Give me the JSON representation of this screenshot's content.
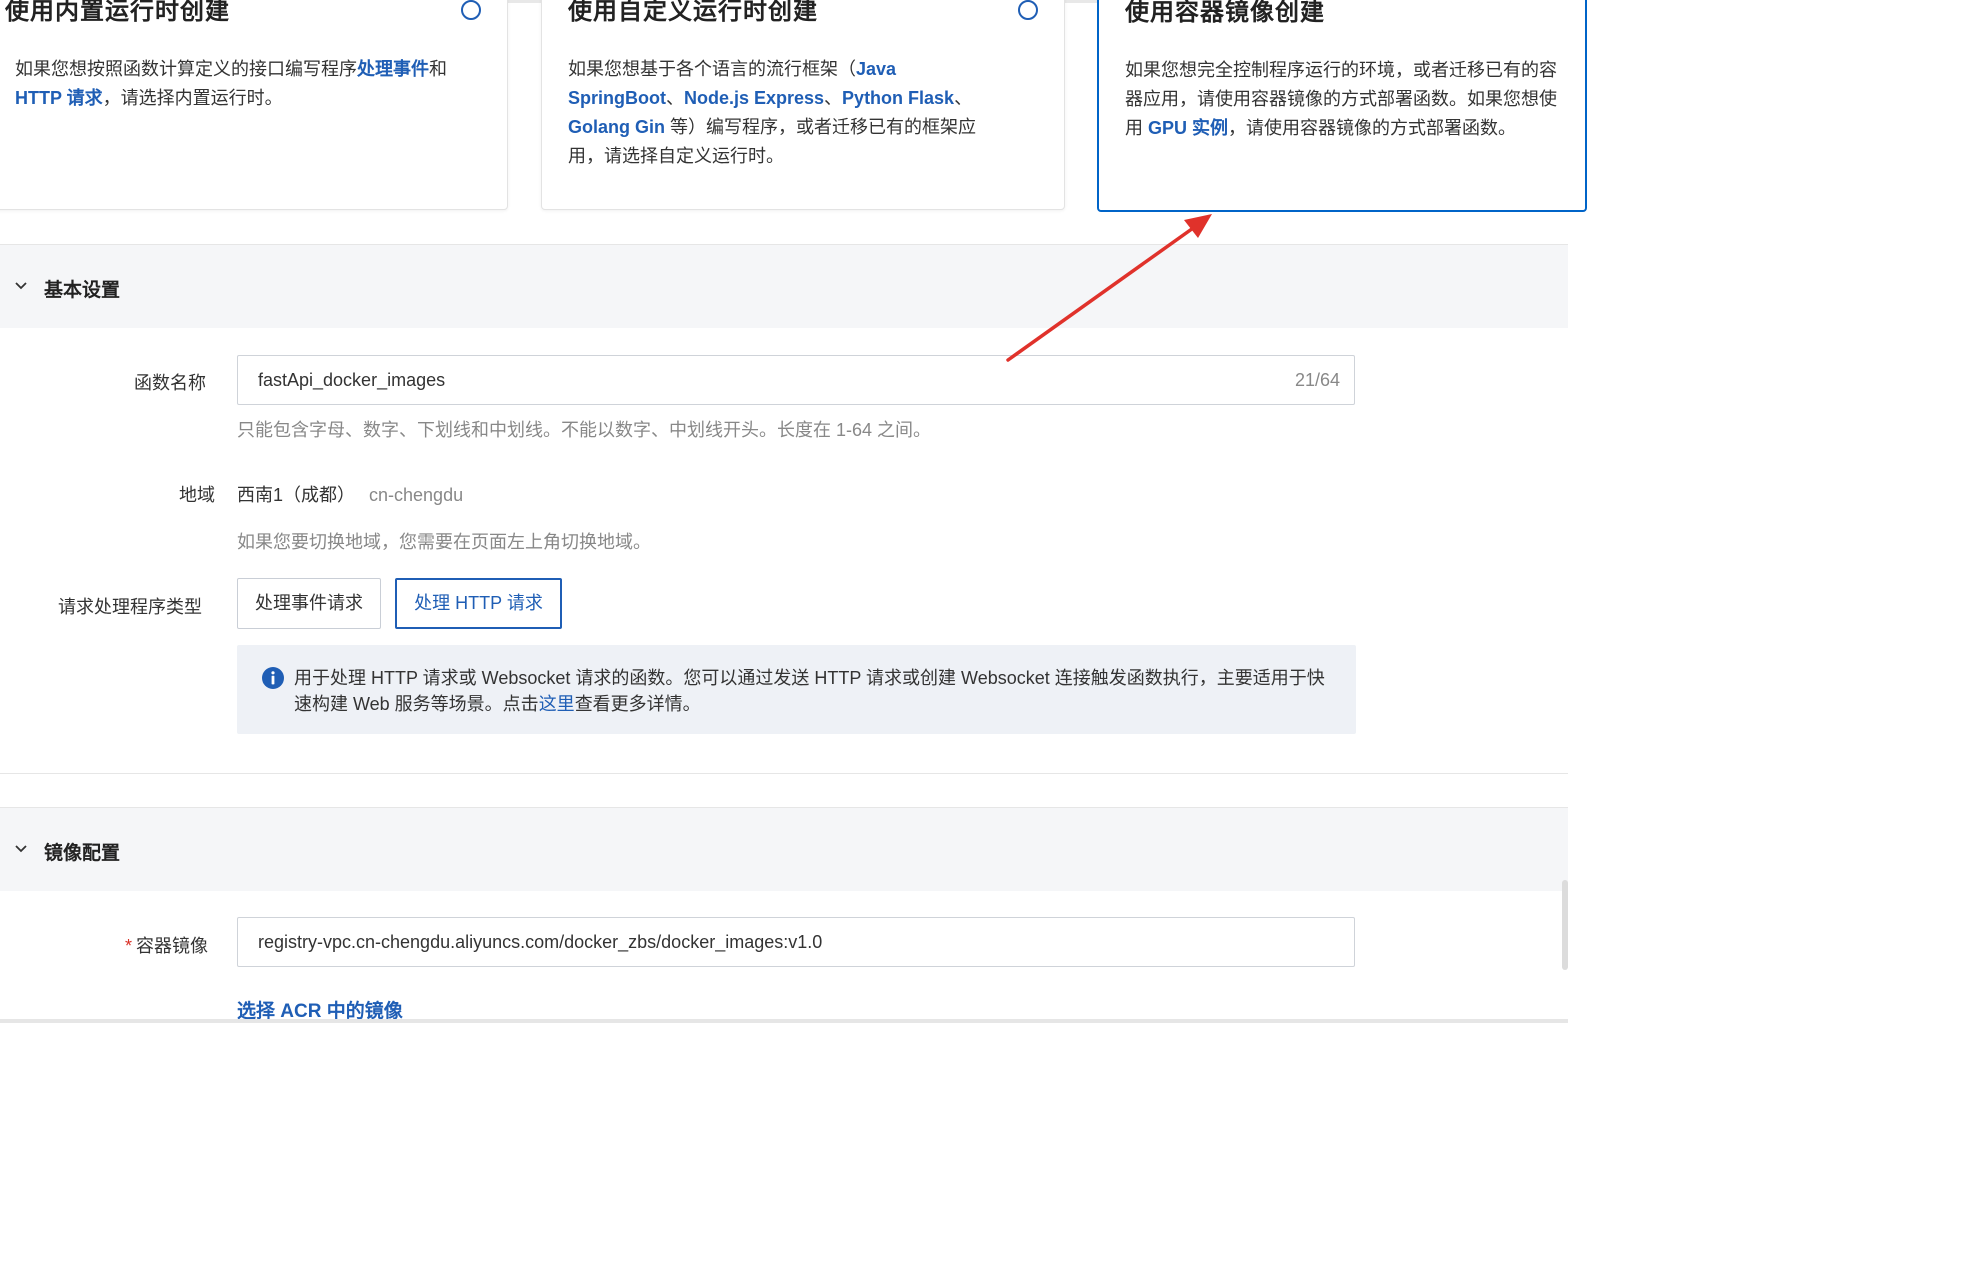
{
  "cards": [
    {
      "title": "使用内置运行时创建",
      "desc_parts": [
        {
          "text": "如果您想按照函数计算定义的接口编写程序",
          "hl": false
        },
        {
          "text": "处理事件",
          "hl": true
        },
        {
          "text": "和\n",
          "hl": false
        },
        {
          "text": "HTTP 请求",
          "hl": true
        },
        {
          "text": "，请选择内置运行时。",
          "hl": false
        }
      ]
    },
    {
      "title": "使用自定义运行时创建",
      "desc_parts": [
        {
          "text": "如果您想基于各个语言的流行框架（",
          "hl": false
        },
        {
          "text": "Java\nSpringBoot",
          "hl": true
        },
        {
          "text": "、",
          "hl": false
        },
        {
          "text": "Node.js Express",
          "hl": true
        },
        {
          "text": "、",
          "hl": false
        },
        {
          "text": "Python Flask",
          "hl": true
        },
        {
          "text": "、\n",
          "hl": false
        },
        {
          "text": "Golang Gin",
          "hl": true
        },
        {
          "text": " 等）编写程序，或者迁移已有的框架应\n用，请选择自定义运行时。",
          "hl": false
        }
      ]
    },
    {
      "title": "使用容器镜像创建",
      "desc_parts": [
        {
          "text": "如果您想完全控制程序运行的环境，或者迁移已有的容\n器应用，请使用容器镜像的方式部署函数。如果您想使\n用 ",
          "hl": false
        },
        {
          "text": "GPU 实例",
          "hl": true
        },
        {
          "text": "，请使用容器镜像的方式部署函数。",
          "hl": false
        }
      ]
    }
  ],
  "basic_settings": {
    "title": "基本设置",
    "function_name": {
      "label": "函数名称",
      "value": "fastApi_docker_images",
      "count": "21/64",
      "hint": "只能包含字母、数字、下划线和中划线。不能以数字、中划线开头。长度在 1-64 之间。"
    },
    "region": {
      "label": "地域",
      "value": "西南1（成都）",
      "code": "cn-chengdu",
      "hint": "如果您要切换地域，您需要在页面左上角切换地域。"
    },
    "handler_type": {
      "label": "请求处理程序类型",
      "options": [
        "处理事件请求",
        "处理 HTTP 请求"
      ],
      "selected": "处理 HTTP 请求",
      "info_text": "用于处理 HTTP 请求或 Websocket 请求的函数。您可以通过发送 HTTP 请求或创建 Websocket 连接触发函数执行，主要适用于快速构建 Web 服务等场景。点击",
      "info_link": "这里",
      "info_suffix": "查看更多详情。"
    }
  },
  "image_config": {
    "title": "镜像配置",
    "container_image": {
      "required_mark": "*",
      "label": "容器镜像",
      "value": "registry-vpc.cn-chengdu.aliyuncs.com/docker_zbs/docker_images:v1.0"
    },
    "acr_link": "选择 ACR 中的镜像"
  },
  "colors": {
    "accent": "#1f5eb5",
    "selected_border": "#0064c8",
    "annotation_arrow": "#e0322b"
  }
}
